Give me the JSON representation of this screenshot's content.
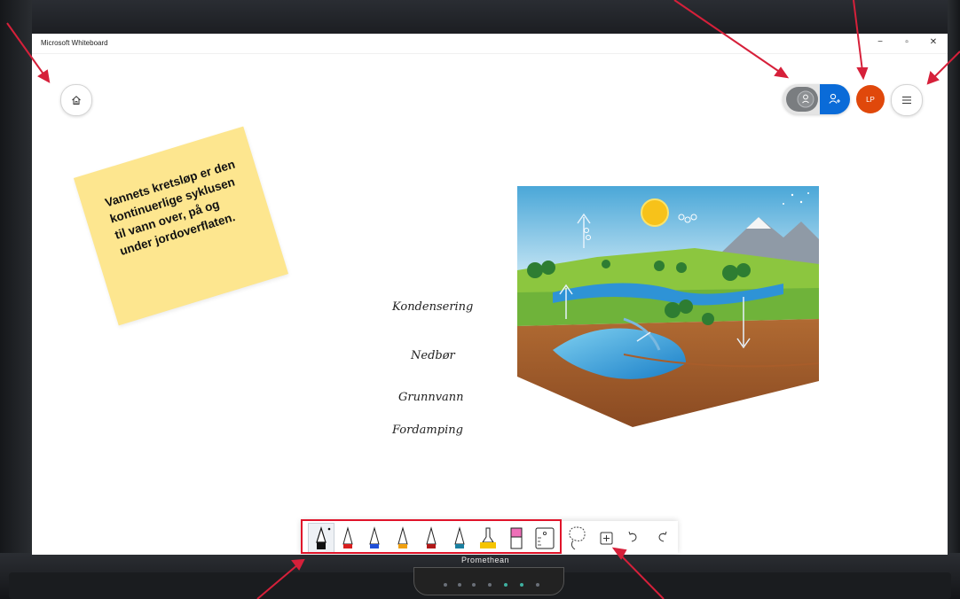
{
  "window": {
    "title": "Microsoft Whiteboard",
    "minimize": "−",
    "restore": "▫",
    "close": "✕"
  },
  "monitor": {
    "brand": "Promethean"
  },
  "header": {
    "avatar_initials": "LP",
    "share_color": "#0a6bd8",
    "avatar_color": "#e0480b"
  },
  "sticky_note": {
    "text": "Vannets kretsløp er den kontinuerlige syklusen til vann over, på og under jordoverflaten.",
    "color": "#fde68f"
  },
  "labels": [
    "Kondensering",
    "Nedbør",
    "Grunnvann",
    "Fordamping"
  ],
  "diagram": {
    "subject": "water-cycle-illustration"
  },
  "toolbar": {
    "pens": [
      {
        "name": "black-pen",
        "color": "#111111"
      },
      {
        "name": "red-pen",
        "color": "#d81e1e"
      },
      {
        "name": "blue-pen",
        "color": "#1f4fd8"
      },
      {
        "name": "orange-pen",
        "color": "#f0a010"
      },
      {
        "name": "dark-red-pen",
        "color": "#b01818"
      },
      {
        "name": "teal-pen",
        "color": "#1a7fa0"
      },
      {
        "name": "yellow-highlighter",
        "color": "#f5c400"
      },
      {
        "name": "pink-eraser",
        "color": "#ee6fb8"
      }
    ],
    "highlight_color": "#e0142a"
  },
  "annotation_arrow_color": "#d6203a"
}
